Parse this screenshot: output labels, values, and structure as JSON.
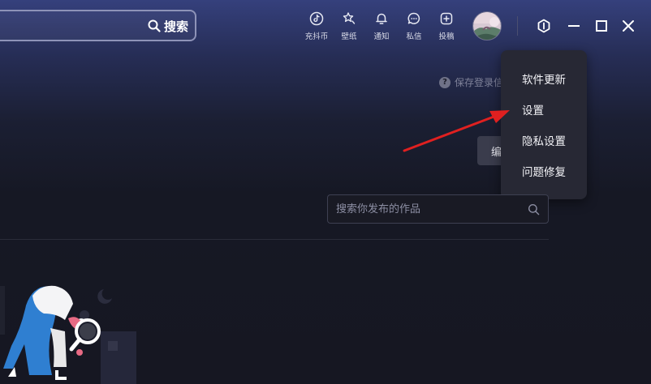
{
  "search": {
    "button_label": "搜索"
  },
  "toolbar": [
    {
      "label": "充抖币",
      "icon": "douyin-coin-icon"
    },
    {
      "label": "壁纸",
      "icon": "wallpaper-icon"
    },
    {
      "label": "通知",
      "icon": "bell-icon"
    },
    {
      "label": "私信",
      "icon": "message-icon"
    },
    {
      "label": "投稿",
      "icon": "upload-plus-icon"
    }
  ],
  "profile": {
    "hint_text": "保存登录信",
    "edit_button_label": "编"
  },
  "menu": {
    "items": [
      "软件更新",
      "设置",
      "隐私设置",
      "问题修复"
    ]
  },
  "works": {
    "search_placeholder": "搜索你发布的作品"
  },
  "colors": {
    "accent_arrow": "#e02020",
    "menu_bg": "#272834",
    "page_bg": "#161722"
  }
}
